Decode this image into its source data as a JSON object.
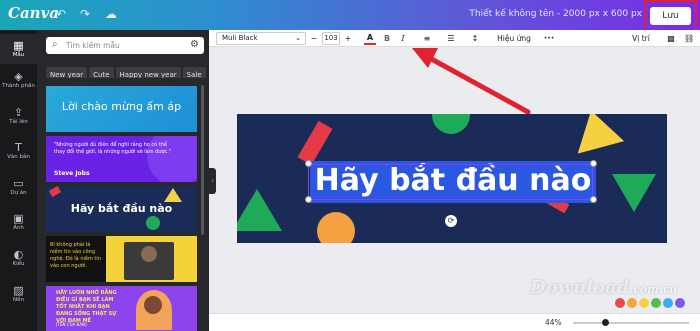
{
  "app": {
    "logo": "Canva",
    "doc_title": "Thiết kế không tên - 2000 px x 600 px",
    "save_label": "Lưu"
  },
  "rail": [
    {
      "label": "Mẫu",
      "icon": "grid-icon"
    },
    {
      "label": "Thành phần",
      "icon": "shapes-icon"
    },
    {
      "label": "Tải lên",
      "icon": "upload-icon"
    },
    {
      "label": "Văn bản",
      "icon": "text-icon"
    },
    {
      "label": "Dự án",
      "icon": "folder-icon"
    },
    {
      "label": "Ảnh",
      "icon": "image-icon"
    },
    {
      "label": "Kiểu",
      "icon": "palette-icon"
    },
    {
      "label": "Nền",
      "icon": "background-icon"
    }
  ],
  "panel": {
    "search_placeholder": "Tìm kiếm mẫu",
    "chips": [
      "New year",
      "Cute",
      "Happy new year",
      "Sale"
    ],
    "templates": [
      {
        "text": "Lời chào mừng ấm áp"
      },
      {
        "text": "\"Những người đủ điên để nghĩ rằng họ có thể thay đổi thế giới, là những người sẽ làm được.\"",
        "author": "Steve Jobs"
      },
      {
        "text": "Hãy bắt đầu nào"
      },
      {
        "text": "Bí không phải là niềm tin vào công nghệ. Đó là niềm tin vào con người."
      },
      {
        "text": "HÃY LUÔN NHỚ RẰNG ĐIỀU GÌ BẠN SẼ LÀM TỐT NHẤT KHI BẠN ĐANG SỐNG THẬT SỰ VỚI ĐAM MÊ",
        "author": "[TÊN CỦA BẠN]"
      }
    ]
  },
  "toolbar": {
    "font": "Muli Black",
    "minus": "−",
    "size": "103",
    "plus": "+",
    "text_color": "A",
    "bold": "B",
    "italic": "I",
    "effects": "Hiệu ứng",
    "more": "•••",
    "position": "Vị trí"
  },
  "canvas": {
    "heading": "Hãy bắt đầu nào"
  },
  "bottom": {
    "zoom": "44%"
  },
  "watermark": {
    "text": "Download",
    "domain": ".com.vn"
  },
  "colors": {
    "accent": "#7d2ae8",
    "highlight_red": "#e0232e",
    "canvas_bg": "#1a2b58"
  }
}
